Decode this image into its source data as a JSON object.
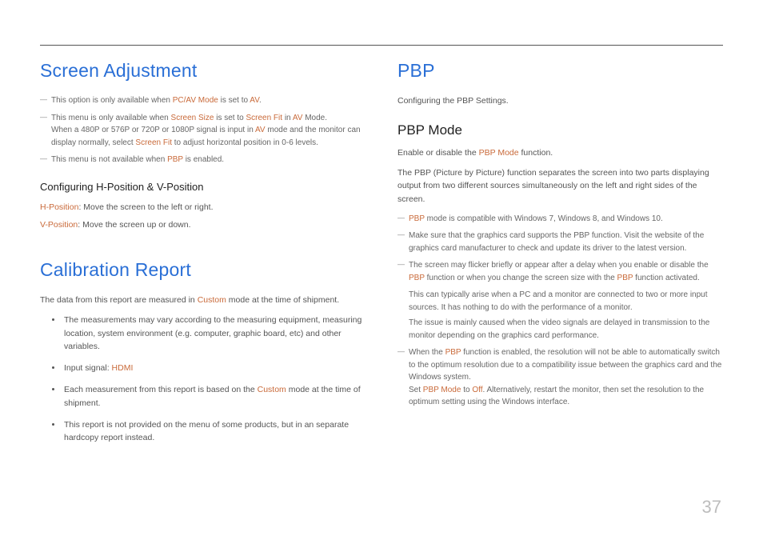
{
  "page_number": "37",
  "left": {
    "h1a": "Screen Adjustment",
    "note1_a": "This option is only available when ",
    "note1_b": "PC/AV Mode",
    "note1_c": " is set to ",
    "note1_d": "AV",
    "note1_e": ".",
    "note2_a": "This menu is only available when ",
    "note2_b": "Screen Size",
    "note2_c": " is set to ",
    "note2_d": "Screen Fit",
    "note2_e": " in ",
    "note2_f": "AV",
    "note2_g": " Mode.",
    "note2_line2a": "When a 480P or 576P or 720P or 1080P signal is input in ",
    "note2_line2b": "AV",
    "note2_line2c": " mode and the monitor can display normally, select ",
    "note2_line2d": "Screen Fit",
    "note2_line2e": " to adjust horizontal position in 0-6 levels.",
    "note3_a": "This menu is not available when ",
    "note3_b": "PBP",
    "note3_c": " is enabled.",
    "h3a": "Configuring H-Position & V-Position",
    "hpos_a": "H-Position",
    "hpos_b": ": Move the screen to the left or right.",
    "vpos_a": "V-Position",
    "vpos_b": ": Move the screen up or down.",
    "h1b": "Calibration Report",
    "cal_intro_a": "The data from this report are measured in ",
    "cal_intro_b": "Custom",
    "cal_intro_c": " mode at the time of shipment.",
    "b1": "The measurements may vary according to the measuring equipment, measuring location, system environment (e.g. computer, graphic board, etc) and other variables.",
    "b2_a": "Input signal: ",
    "b2_b": "HDMI",
    "b3_a": "Each measurement from this report is based on the ",
    "b3_b": "Custom",
    "b3_c": " mode at the time of shipment.",
    "b4": "This report is not provided on the menu of some products, but in an separate hardcopy report instead."
  },
  "right": {
    "h1": "PBP",
    "intro": "Configuring the PBP Settings.",
    "h2": "PBP Mode",
    "enable_a": "Enable or disable the ",
    "enable_b": "PBP Mode",
    "enable_c": " function.",
    "desc": "The PBP (Picture by Picture) function separates the screen into two parts displaying output from two different sources simultaneously on the left and right sides of the screen.",
    "n1_a": "PBP",
    "n1_b": " mode is compatible with Windows 7, Windows 8, and Windows 10.",
    "n2": "Make sure that the graphics card supports the PBP function. Visit the website of the graphics card manufacturer to check and update its driver to the latest version.",
    "n3_a": "The screen may flicker briefly or appear after a delay when you enable or disable the ",
    "n3_b": "PBP",
    "n3_c": " function or when you change the screen size with the ",
    "n3_d": "PBP",
    "n3_e": " function activated.",
    "n3_sub1": "This can typically arise when a PC and a monitor are connected to two or more input sources. It has nothing to do with the performance of a monitor.",
    "n3_sub2": "The issue is mainly caused when the video signals are delayed in transmission to the monitor depending on the graphics card performance.",
    "n4_a": "When the ",
    "n4_b": "PBP",
    "n4_c": " function is enabled, the resolution will not be able to automatically switch to the optimum resolution due to a compatibility issue between the graphics card and the Windows system.",
    "n4_line2a": "Set ",
    "n4_line2b": "PBP Mode",
    "n4_line2c": " to ",
    "n4_line2d": "Off",
    "n4_line2e": ". Alternatively, restart the monitor, then set the resolution to the optimum setting using the Windows interface."
  }
}
